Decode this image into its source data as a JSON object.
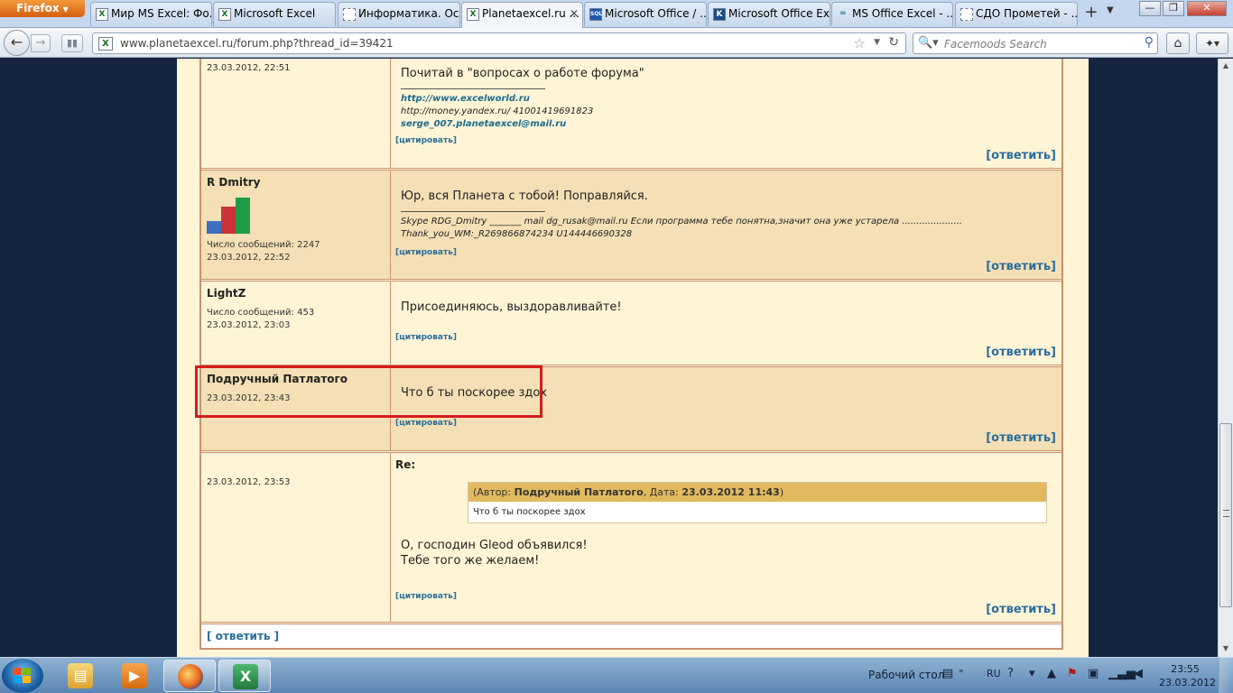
{
  "browser": {
    "menu_label": "Firefox",
    "tabs": [
      {
        "label": "Мир MS Excel: Фо...",
        "icon": "X"
      },
      {
        "label": "Microsoft Excel",
        "icon": "X"
      },
      {
        "label": "Информатика. Ос...",
        "icon": ""
      },
      {
        "label": "Planetaexcel.ru ...",
        "icon": "X"
      },
      {
        "label": "Microsoft Office / ...",
        "icon": "SQL"
      },
      {
        "label": "Microsoft Office Ex...",
        "icon": "K"
      },
      {
        "label": "MS Office Excel - ...",
        "icon": "∞"
      },
      {
        "label": "СДО Прометей - ...",
        "icon": ""
      }
    ],
    "active_tab_index": 3,
    "url": "www.planetaexcel.ru/forum.php?thread_id=39421",
    "search_placeholder": "Facemoods Search"
  },
  "posts": [
    {
      "author": "",
      "date": "23.03.2012, 22:51",
      "body": "Почитай в \"вопросах о работе форума\"",
      "signature": [
        "http://www.excelworld.ru",
        "http://money.yandex.ru/ 41001419691823",
        "serge_007.planetaexcel@mail.ru"
      ],
      "quote_label": "[цитировать]",
      "reply_label": "[ответить]"
    },
    {
      "author": "R Dmitry",
      "count_label": "Число сообщений: 2247",
      "date": "23.03.2012, 22:52",
      "body": "Юр, вся Планета с тобой! Поправляйся.",
      "signature": [
        "Skype RDG_Dmitry _______ mail dg_rusak@mail.ru Если программа тебе понятна,значит она уже устарела .....................",
        "Thank_you_WM:_R269866874234 U144446690328"
      ],
      "quote_label": "[цитировать]",
      "reply_label": "[ответить]"
    },
    {
      "author": "LightZ",
      "count_label": "Число сообщений: 453",
      "date": "23.03.2012, 23:03",
      "body": "Присоединяюсь, выздоравливайте!",
      "quote_label": "[цитировать]",
      "reply_label": "[ответить]"
    },
    {
      "author": "Подручный Патлатого",
      "date": "23.03.2012, 23:43",
      "body": "Что б ты поскорее здох",
      "quote_label": "[цитировать]",
      "reply_label": "[ответить]"
    },
    {
      "author": "",
      "date": "23.03.2012, 23:53",
      "subject": "Re:",
      "quote": {
        "prefix": "(Автор: ",
        "author": "Подручный Патлатого",
        "mid": ", Дата: ",
        "date": "23.03.2012 11:43",
        "suffix": ")",
        "text": "Что б ты поскорее здох"
      },
      "body_lines": [
        "О, господин Gleod объявился!",
        "Тебе того же желаем!"
      ],
      "quote_label": "[цитировать]",
      "reply_label": "[ответить]"
    }
  ],
  "footer_reply": "[ ответить ]",
  "taskbar": {
    "desktop_label": "Рабочий стол",
    "lang": "RU",
    "time": "23:55",
    "date": "23.03.2012"
  },
  "colors": {
    "highlight": "#d21c1c",
    "link": "#2c6e9b",
    "post_bg": "#fff4d6",
    "post_alt_bg": "#f4e0b4"
  }
}
